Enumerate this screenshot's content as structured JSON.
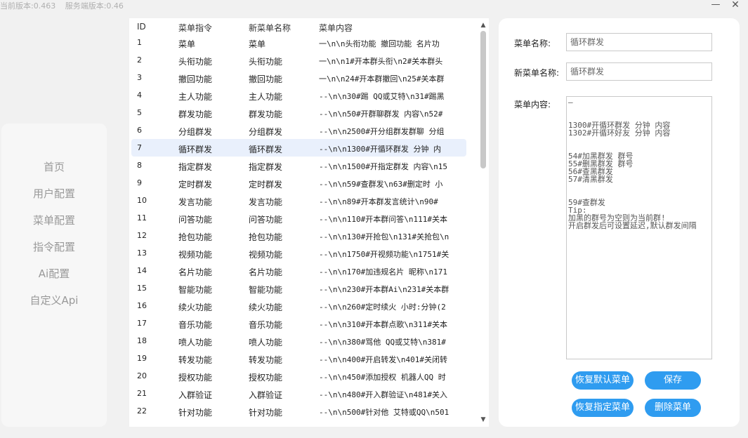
{
  "header": {
    "client_version": "当前版本:0.463",
    "server_version": "服务端版本:0.46",
    "minimize": "—",
    "close": "✕"
  },
  "sidebar": {
    "items": [
      {
        "label": "首页"
      },
      {
        "label": "用户配置"
      },
      {
        "label": "菜单配置"
      },
      {
        "label": "指令配置"
      },
      {
        "label": "Ai配置"
      },
      {
        "label": "自定义Api"
      }
    ]
  },
  "table": {
    "columns": [
      "ID",
      "菜单指令",
      "新菜单名称",
      "菜单内容"
    ],
    "selected_id": "7",
    "rows": [
      {
        "id": "1",
        "cmd": "菜单",
        "name": "菜单",
        "content": "一\\n\\n头衔功能 撤回功能 名片功"
      },
      {
        "id": "2",
        "cmd": "头衔功能",
        "name": "头衔功能",
        "content": "一\\n\\n1#开本群头衔\\n2#关本群头"
      },
      {
        "id": "3",
        "cmd": "撤回功能",
        "name": "撤回功能",
        "content": "一\\n\\n24#开本群撤回\\n25#关本群"
      },
      {
        "id": "4",
        "cmd": "主人功能",
        "name": "主人功能",
        "content": "--\\n\\n30#踢 QQ或艾特\\n31#踢黑"
      },
      {
        "id": "5",
        "cmd": "群发功能",
        "name": "群发功能",
        "content": "--\\n\\n50#开群聊群发 内容\\n52#"
      },
      {
        "id": "6",
        "cmd": "分组群发",
        "name": "分组群发",
        "content": "--\\n\\n2500#开分组群发群聊 分组"
      },
      {
        "id": "7",
        "cmd": "循环群发",
        "name": "循环群发",
        "content": "--\\n\\n1300#开循环群发 分钟 内"
      },
      {
        "id": "8",
        "cmd": "指定群发",
        "name": "指定群发",
        "content": "--\\n\\n1500#开指定群发 内容\\n15"
      },
      {
        "id": "9",
        "cmd": "定时群发",
        "name": "定时群发",
        "content": "--\\n\\n59#查群发\\n63#删定时 小"
      },
      {
        "id": "10",
        "cmd": "发言功能",
        "name": "发言功能",
        "content": "--\\n\\n89#开本群发言统计\\n90#"
      },
      {
        "id": "11",
        "cmd": "问答功能",
        "name": "问答功能",
        "content": "--\\n\\n110#开本群问答\\n111#关本"
      },
      {
        "id": "12",
        "cmd": "抢包功能",
        "name": "抢包功能",
        "content": "--\\n\\n130#开抢包\\n131#关抢包\\n"
      },
      {
        "id": "13",
        "cmd": "视频功能",
        "name": "视频功能",
        "content": "--\\n\\n1750#开视频功能\\n1751#关"
      },
      {
        "id": "14",
        "cmd": "名片功能",
        "name": "名片功能",
        "content": "--\\n\\n170#加违规名片 昵称\\n171"
      },
      {
        "id": "15",
        "cmd": "智能功能",
        "name": "智能功能",
        "content": "--\\n\\n230#开本群Ai\\n231#关本群"
      },
      {
        "id": "16",
        "cmd": "续火功能",
        "name": "续火功能",
        "content": "--\\n\\n260#定时续火 小时:分钟(2"
      },
      {
        "id": "17",
        "cmd": "音乐功能",
        "name": "音乐功能",
        "content": "--\\n\\n310#开本群点歌\\n311#关本"
      },
      {
        "id": "18",
        "cmd": "喷人功能",
        "name": "喷人功能",
        "content": "--\\n\\n380#骂他 QQ或艾特\\n381#"
      },
      {
        "id": "19",
        "cmd": "转发功能",
        "name": "转发功能",
        "content": "--\\n\\n400#开启转发\\n401#关闭转"
      },
      {
        "id": "20",
        "cmd": "授权功能",
        "name": "授权功能",
        "content": "--\\n\\n450#添加授权 机器人QQ 时"
      },
      {
        "id": "21",
        "cmd": "入群验证",
        "name": "入群验证",
        "content": "--\\n\\n480#开入群验证\\n481#关入"
      },
      {
        "id": "22",
        "cmd": "针对功能",
        "name": "针对功能",
        "content": "--\\n\\n500#针对他 艾特或QQ\\n501"
      }
    ]
  },
  "editor": {
    "menu_name_label": "菜单名称:",
    "menu_name_value": "循环群发",
    "new_name_label": "新菜单名称:",
    "new_name_value": "循环群发",
    "content_label": "菜单内容:",
    "content_lines": [
      "—",
      "",
      "",
      "1300#开循环群发 分钟 内容",
      "1302#开循环好友 分钟 内容",
      "",
      "",
      "54#加黑群发 群号",
      "55#删黑群发 群号",
      "56#查黑群发",
      "57#清黑群发",
      "",
      "",
      "59#查群发",
      "Tip:",
      "加黑的群号为空则为当前群!",
      "开启群发后可设置延迟,默认群发间隔"
    ],
    "buttons": {
      "restore_default": "恢复默认菜单",
      "save": "保存",
      "restore_specified": "恢复指定菜单",
      "delete": "删除菜单"
    }
  },
  "colors": {
    "accent": "#2f9cf0",
    "selected_row": "#e9f0fc",
    "sidebar_text": "#999999"
  }
}
